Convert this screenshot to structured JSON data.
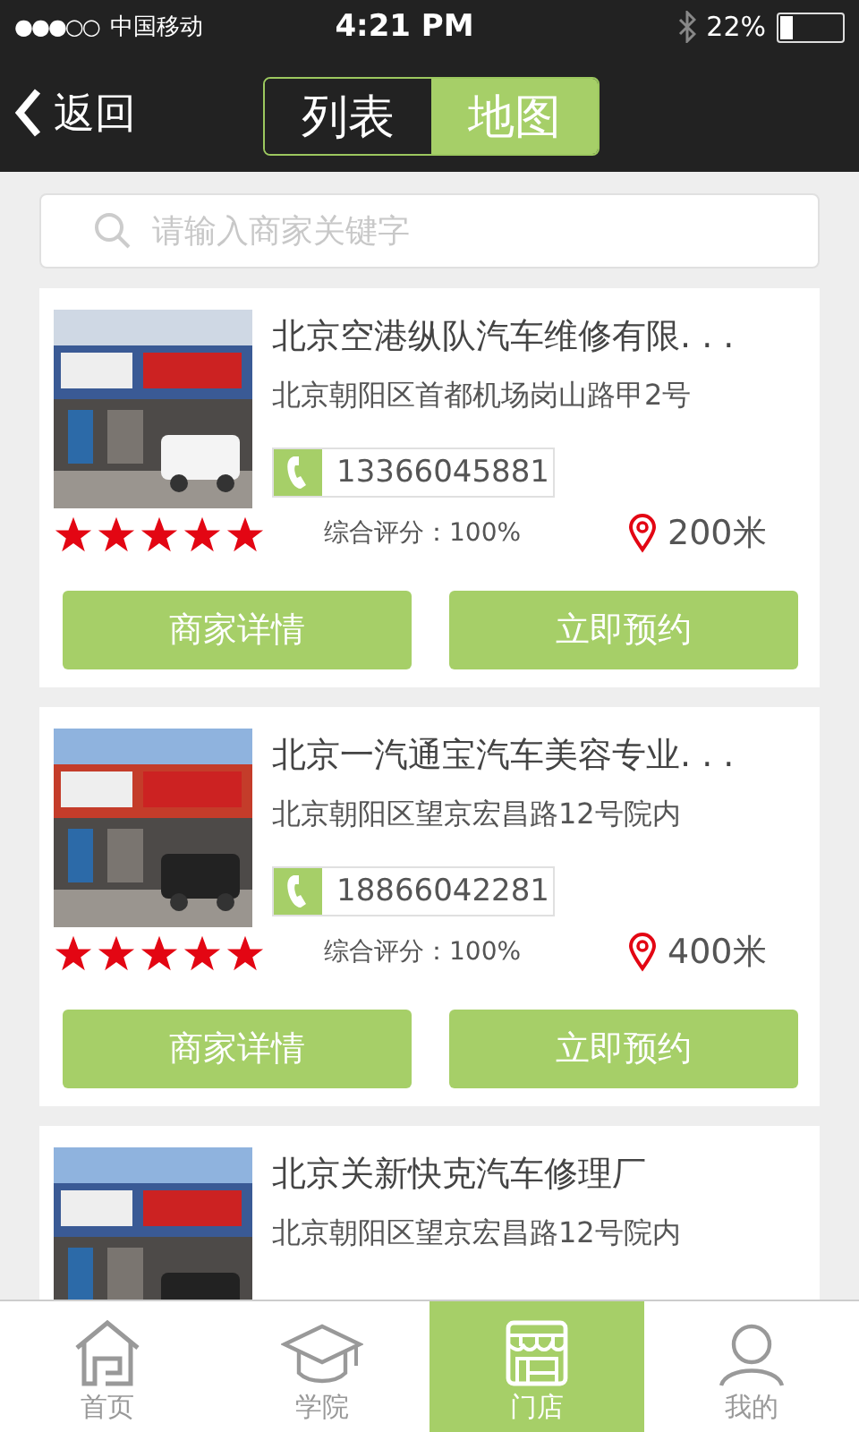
{
  "status_bar": {
    "carrier": "中国移动",
    "signal_dots": "●●●○○",
    "time": "4:21 PM",
    "battery": "22%"
  },
  "nav": {
    "back": "返回",
    "tabs": [
      {
        "label": "列表",
        "selected": false
      },
      {
        "label": "地图",
        "selected": true
      }
    ]
  },
  "search": {
    "placeholder": "请输入商家关键字"
  },
  "shops": [
    {
      "name": "北京空港纵队汽车维修有限. . .",
      "address": "北京朝阳区首都机场岗山路甲2号",
      "phone": "13366045881",
      "stars": 5,
      "score": "综合评分：100%",
      "distance": "200米",
      "buttons": [
        "商家详情",
        "立即预约"
      ]
    },
    {
      "name": "北京一汽通宝汽车美容专业. . .",
      "address": "北京朝阳区望京宏昌路12号院内",
      "phone": "18866042281",
      "stars": 5,
      "score": "综合评分：100%",
      "distance": "400米",
      "buttons": [
        "商家详情",
        "立即预约"
      ]
    },
    {
      "name": "北京关新快克汽车修理厂",
      "address": "北京朝阳区望京宏昌路12号院内"
    }
  ],
  "tab_bar": [
    {
      "label": "首页",
      "kind": "home",
      "selected": false
    },
    {
      "label": "学院",
      "kind": "academy",
      "selected": false
    },
    {
      "label": "门店",
      "kind": "store",
      "selected": true
    },
    {
      "label": "我的",
      "kind": "user",
      "selected": false
    }
  ]
}
